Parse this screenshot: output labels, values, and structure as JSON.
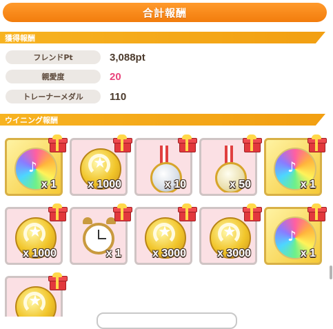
{
  "title": "合計報酬",
  "acquired_section": {
    "header": "獲得報酬",
    "rows": [
      {
        "label": "フレンドPt",
        "value": "3,088pt"
      },
      {
        "label": "親愛度",
        "value": "20"
      },
      {
        "label": "トレーナーメダル",
        "value": "110"
      }
    ]
  },
  "winning_section": {
    "header": "ウイニング報酬",
    "items": [
      {
        "kind": "rainbow-disc",
        "qty": "x 1"
      },
      {
        "kind": "gold-coin",
        "qty": "x 1000"
      },
      {
        "kind": "silver-medal",
        "qty": "x 10"
      },
      {
        "kind": "gold-medal",
        "qty": "x 50"
      },
      {
        "kind": "rainbow-disc",
        "qty": "x 1"
      },
      {
        "kind": "gold-coin",
        "qty": "x 1000"
      },
      {
        "kind": "alarm-clock",
        "qty": "x 1"
      },
      {
        "kind": "gold-coin",
        "qty": "x 3000"
      },
      {
        "kind": "gold-coin",
        "qty": "x 3000"
      },
      {
        "kind": "rainbow-disc",
        "qty": "x 1"
      },
      {
        "kind": "gold-coin",
        "qty": ""
      }
    ]
  },
  "colors": {
    "accent_orange": "#f58412",
    "section_yellow": "#f5aa1a",
    "pink_value": "#e9447c"
  }
}
